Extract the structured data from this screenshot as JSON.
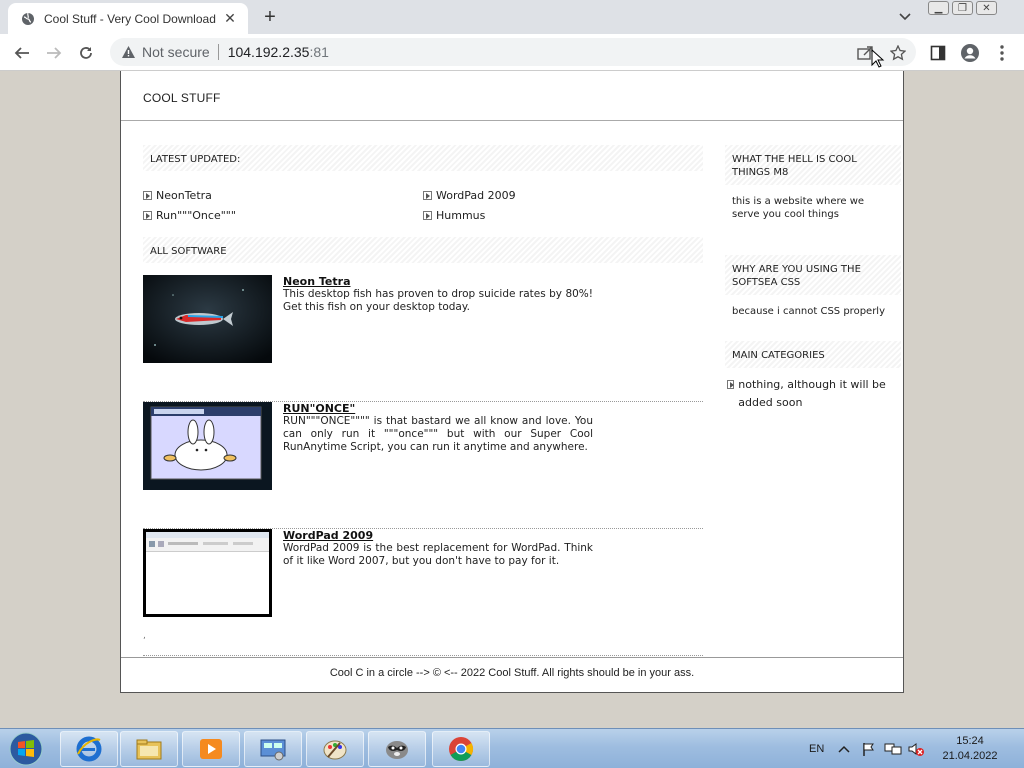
{
  "browser": {
    "tab_title": "Cool Stuff - Very Cool Download",
    "not_secure_label": "Not secure",
    "url_host": "104.192.2.35",
    "url_port": ":81"
  },
  "site": {
    "title": "COOL STUFF",
    "latest_heading": "LATEST UPDATED:",
    "latest_items": [
      "NeonTetra",
      "WordPad 2009",
      "Run\"\"\"Once\"\"\"",
      "Hummus"
    ],
    "all_heading": "ALL SOFTWARE",
    "entries": [
      {
        "title": "Neon Tetra",
        "description": "This desktop fish has proven to drop suicide rates by 80%! Get this fish on your desktop today."
      },
      {
        "title": "RUN\"ONCE\"",
        "description": "RUN\"\"\"ONCE\"\"\"\" is that bastard we all know and love. You can only run it \"\"\"once\"\"\" but with our Super Cool RunAnytime Script, you can run it anytime and anywhere."
      },
      {
        "title": "WordPad 2009",
        "description": "WordPad 2009 is the best replacement for WordPad. Think of it like Word 2007, but you don't have to pay for it."
      }
    ],
    "stray_mark": ",",
    "sidebar": {
      "about_heading": "WHAT THE HELL IS COOL THINGS M8",
      "about_text": "this is a website where we serve you cool things",
      "why_heading": "WHY ARE YOU USING THE SOFTSEA CSS",
      "why_text": "because i cannot CSS properly",
      "categories_heading": "MAIN CATEGORIES",
      "categories": [
        "nothing, although it will be added soon"
      ]
    },
    "footer": "Cool C in a circle --> © <-- 2022 Cool Stuff. All rights should be in your ass."
  },
  "taskbar": {
    "language": "EN",
    "time": "15:24",
    "date": "21.04.2022"
  }
}
